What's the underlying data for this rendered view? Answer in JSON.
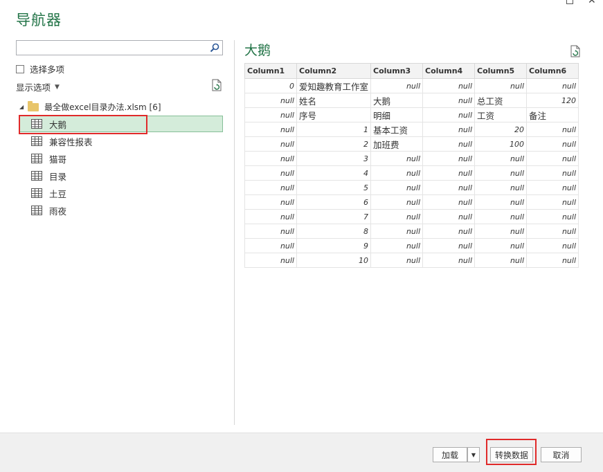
{
  "window": {
    "title": "导航器"
  },
  "search": {
    "placeholder": "",
    "value": ""
  },
  "options": {
    "select_multiple": "选择多项",
    "display_options": "显示选项"
  },
  "tree": {
    "root_label": "最全做excel目录办法.xlsm [6]",
    "items": [
      {
        "label": "大鹅",
        "selected": true
      },
      {
        "label": "兼容性报表",
        "selected": false
      },
      {
        "label": "猫哥",
        "selected": false
      },
      {
        "label": "目录",
        "selected": false
      },
      {
        "label": "土豆",
        "selected": false
      },
      {
        "label": "雨夜",
        "selected": false
      }
    ]
  },
  "preview": {
    "title": "大鹅",
    "columns": [
      "Column1",
      "Column2",
      "Column3",
      "Column4",
      "Column5",
      "Column6"
    ],
    "rows": [
      [
        "0",
        "爱知趣教育工作室",
        "null",
        "null",
        "null",
        "null"
      ],
      [
        "null",
        "姓名",
        "大鹅",
        "null",
        "总工资",
        "120"
      ],
      [
        "null",
        "序号",
        "明细",
        "null",
        "工资",
        "备注"
      ],
      [
        "null",
        "1",
        "基本工资",
        "null",
        "20",
        "null"
      ],
      [
        "null",
        "2",
        "加班费",
        "null",
        "100",
        "null"
      ],
      [
        "null",
        "3",
        "null",
        "null",
        "null",
        "null"
      ],
      [
        "null",
        "4",
        "null",
        "null",
        "null",
        "null"
      ],
      [
        "null",
        "5",
        "null",
        "null",
        "null",
        "null"
      ],
      [
        "null",
        "6",
        "null",
        "null",
        "null",
        "null"
      ],
      [
        "null",
        "7",
        "null",
        "null",
        "null",
        "null"
      ],
      [
        "null",
        "8",
        "null",
        "null",
        "null",
        "null"
      ],
      [
        "null",
        "9",
        "null",
        "null",
        "null",
        "null"
      ],
      [
        "null",
        "10",
        "null",
        "null",
        "null",
        "null"
      ]
    ]
  },
  "footer": {
    "load": "加载",
    "transform": "转换数据",
    "cancel": "取消"
  },
  "colors": {
    "accent": "#217346",
    "selected_bg": "#d4ecda",
    "highlight": "#e02a2a"
  },
  "icons": {
    "search": "search-icon",
    "refresh": "refresh-icon",
    "table": "table-icon",
    "folder": "folder-icon"
  }
}
